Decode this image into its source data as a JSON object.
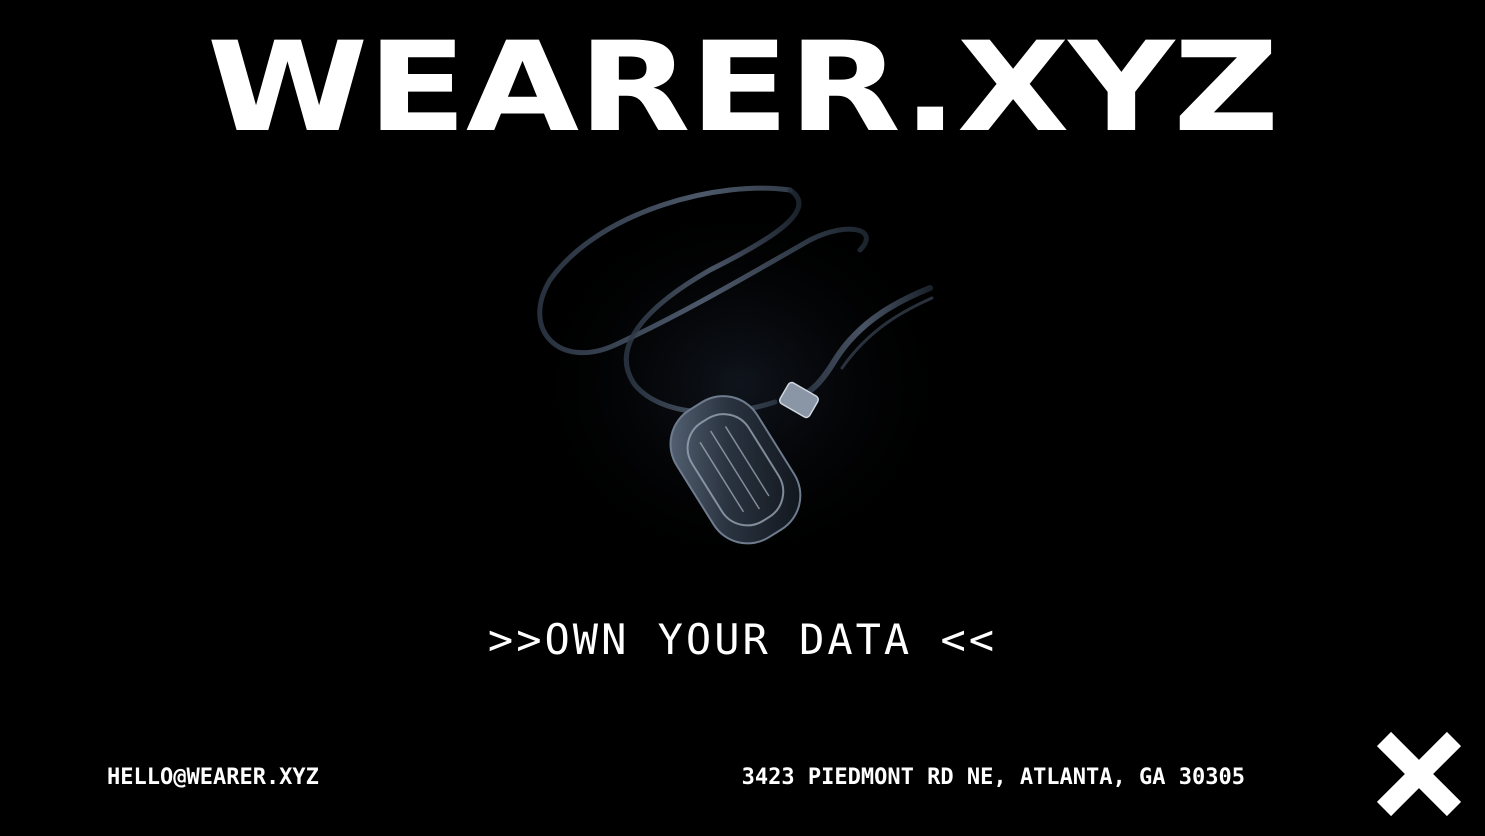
{
  "header": {
    "title": "WEARER.XYZ"
  },
  "hero": {
    "image_icon": "pendant-necklace-image",
    "tagline": ">>OWN YOUR DATA <<"
  },
  "footer": {
    "email": "HELLO@WEARER.XYZ",
    "address": "3423 PIEDMONT RD NE, ATLANTA, GA 30305",
    "close_icon": "close-x-icon"
  },
  "colors": {
    "background": "#000000",
    "text": "#ffffff"
  }
}
